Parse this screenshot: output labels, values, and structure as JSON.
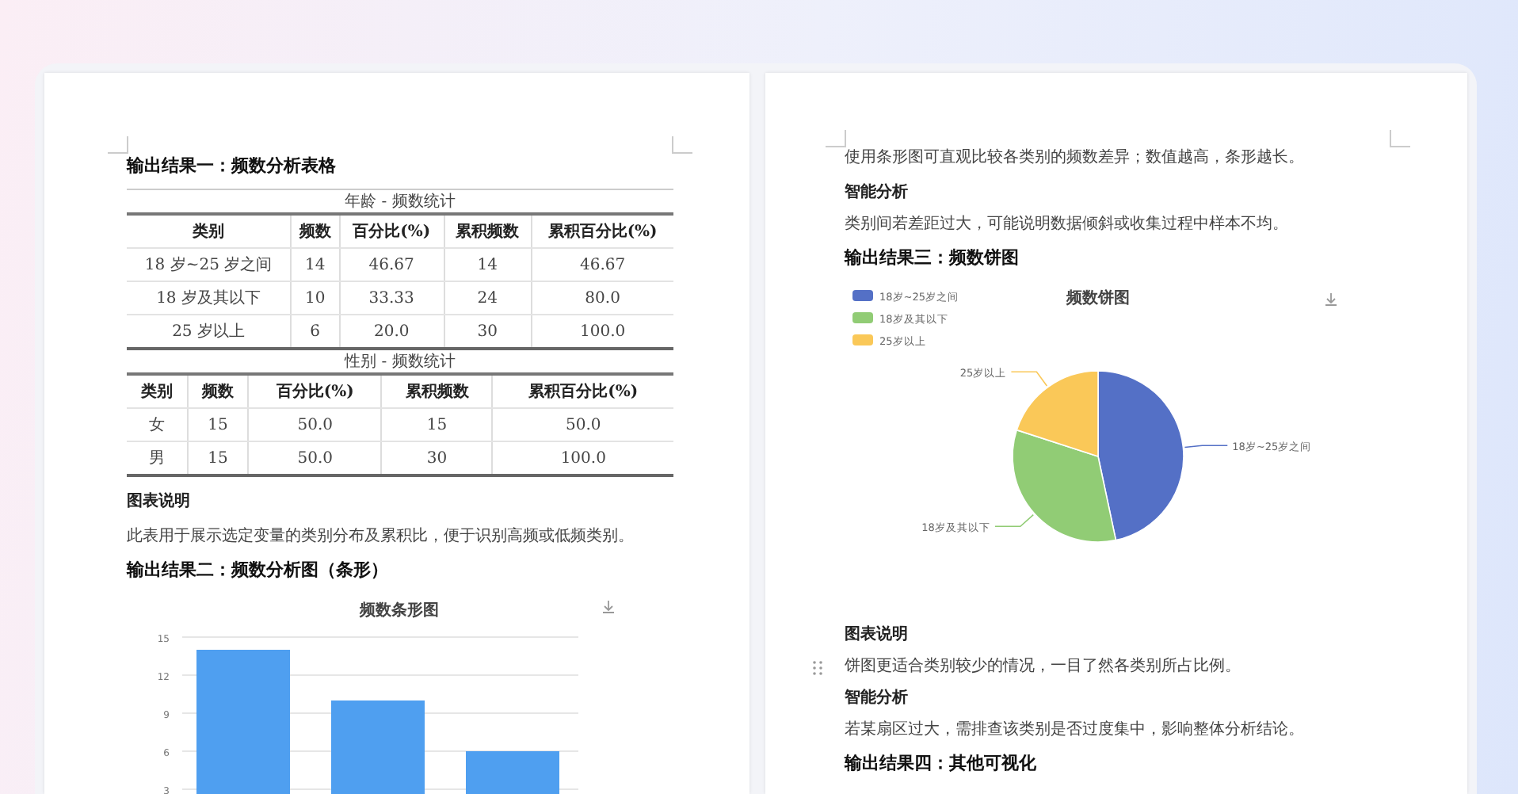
{
  "left_page": {
    "heading_1": "输出结果一：频数分析表格",
    "tables": [
      {
        "caption": "年龄 - 频数统计",
        "columns": [
          "类别",
          "频数",
          "百分比(%)",
          "累积频数",
          "累积百分比(%)"
        ],
        "rows": [
          [
            "18 岁~25 岁之间",
            "14",
            "46.67",
            "14",
            "46.67"
          ],
          [
            "18 岁及其以下",
            "10",
            "33.33",
            "24",
            "80.0"
          ],
          [
            "25 岁以上",
            "6",
            "20.0",
            "30",
            "100.0"
          ]
        ]
      },
      {
        "caption": "性别 - 频数统计",
        "columns": [
          "类别",
          "频数",
          "百分比(%)",
          "累积频数",
          "累积百分比(%)"
        ],
        "rows": [
          [
            "女",
            "15",
            "50.0",
            "15",
            "50.0"
          ],
          [
            "男",
            "15",
            "50.0",
            "30",
            "100.0"
          ]
        ]
      }
    ],
    "note_title": "图表说明",
    "note_text": "此表用于展示选定变量的类别分布及累积比，便于识别高频或低频类别。",
    "heading_2": "输出结果二：频数分析图（条形）",
    "bar_chart": {
      "chart_data": {
        "type": "bar",
        "title": "频数条形图",
        "values": [
          14,
          10,
          6
        ],
        "yticks": [
          3,
          6,
          9,
          12,
          15
        ],
        "ylim": [
          0,
          15
        ],
        "grid": true
      }
    }
  },
  "right_page": {
    "intro_text": "使用条形图可直观比较各类别的频数差异；数值越高，条形越长。",
    "analysis_title": "智能分析",
    "analysis_text": "类别间若差距过大，可能说明数据倾斜或收集过程中样本不均。",
    "heading_3": "输出结果三：频数饼图",
    "pie_chart": {
      "legend": [
        {
          "label": "18岁~25岁之间",
          "color": "#5470c6"
        },
        {
          "label": "18岁及其以下",
          "color": "#91cc75"
        },
        {
          "label": "25岁以上",
          "color": "#fac858"
        }
      ],
      "chart_data": {
        "type": "pie",
        "title": "频数饼图",
        "categories": [
          "18岁~25岁之间",
          "18岁及其以下",
          "25岁以上"
        ],
        "values": [
          46.67,
          33.33,
          20.0
        ]
      }
    },
    "note_title": "图表说明",
    "note_text": "饼图更适合类别较少的情况，一目了然各类别所占比例。",
    "analysis_title_2": "智能分析",
    "analysis_text_2": "若某扇区过大，需排查该类别是否过度集中，影响整体分析结论。",
    "heading_4": "输出结果四：其他可视化"
  }
}
